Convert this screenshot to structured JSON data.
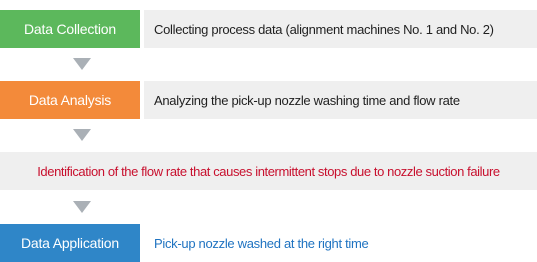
{
  "colors": {
    "collection": "#5cb85c",
    "analysis": "#f38a3a",
    "application": "#2f86c8",
    "finding_text": "#c8102e",
    "application_text": "#1f73c1",
    "arrow": "#aab0b6",
    "panel": "#efefef"
  },
  "steps": {
    "collection": {
      "label": "Data Collection",
      "description": "Collecting process data (alignment machines No. 1 and No. 2)"
    },
    "analysis": {
      "label": "Data Analysis",
      "description": "Analyzing the pick-up nozzle washing time and flow rate"
    },
    "finding": {
      "text": "Identification of the flow rate that causes intermittent stops due to nozzle suction failure"
    },
    "application": {
      "label": "Data Application",
      "description": "Pick-up nozzle washed at the right time"
    }
  },
  "arrows": [
    "arrow-down-icon",
    "arrow-down-icon",
    "arrow-down-icon"
  ]
}
